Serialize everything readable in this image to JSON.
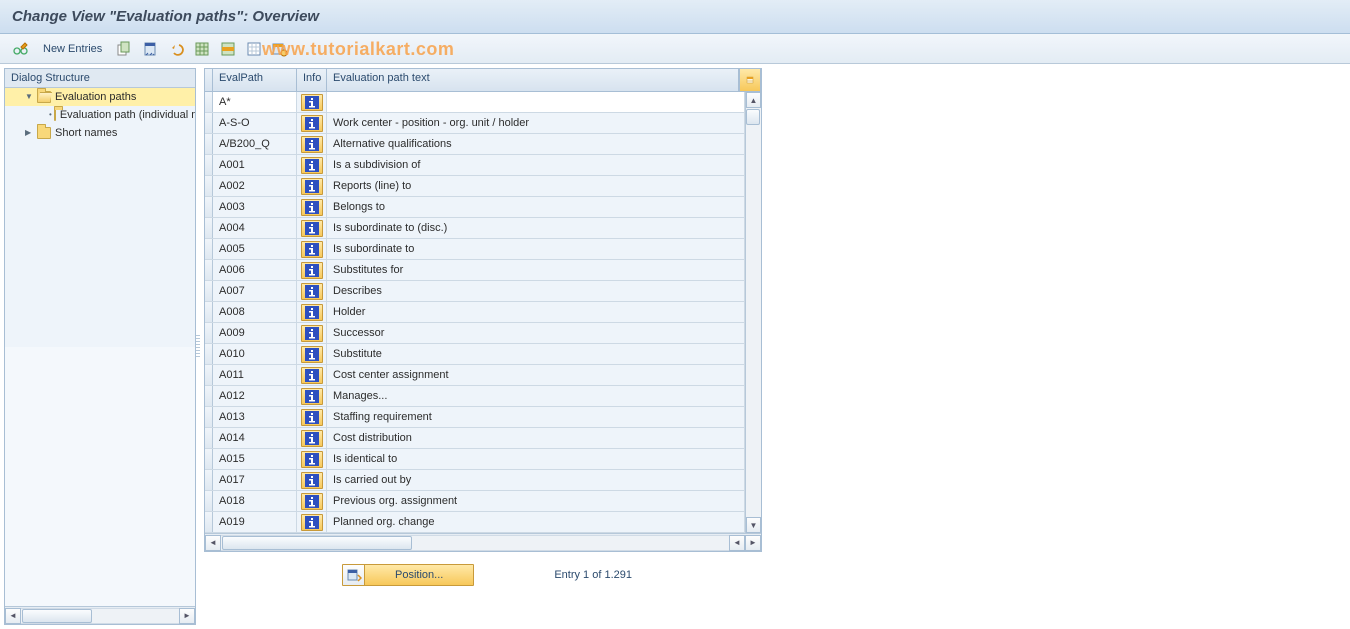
{
  "title": "Change View \"Evaluation paths\": Overview",
  "watermark": "www.tutorialkart.com",
  "toolbar": {
    "new_entries": "New Entries"
  },
  "tree": {
    "header": "Dialog Structure",
    "items": [
      {
        "label": "Evaluation paths",
        "open": true,
        "level": 1,
        "selected": true
      },
      {
        "label": "Evaluation path (individual maint.)",
        "open": false,
        "level": 2,
        "selected": false
      },
      {
        "label": "Short names",
        "open": false,
        "level": 1,
        "selected": false
      }
    ]
  },
  "grid": {
    "headers": {
      "path": "EvalPath",
      "info": "Info",
      "text": "Evaluation path text"
    },
    "rows": [
      {
        "path": "A*",
        "text": "",
        "active": true
      },
      {
        "path": "A-S-O",
        "text": "Work center - position - org. unit / holder"
      },
      {
        "path": "A/B200_Q",
        "text": "Alternative qualifications"
      },
      {
        "path": "A001",
        "text": "Is a subdivision of"
      },
      {
        "path": "A002",
        "text": "Reports (line) to"
      },
      {
        "path": "A003",
        "text": "Belongs to"
      },
      {
        "path": "A004",
        "text": "Is subordinate to (disc.)"
      },
      {
        "path": "A005",
        "text": "Is subordinate to"
      },
      {
        "path": "A006",
        "text": "Substitutes for"
      },
      {
        "path": "A007",
        "text": "Describes"
      },
      {
        "path": "A008",
        "text": "Holder"
      },
      {
        "path": "A009",
        "text": "Successor"
      },
      {
        "path": "A010",
        "text": "Substitute"
      },
      {
        "path": "A011",
        "text": "Cost center assignment"
      },
      {
        "path": "A012",
        "text": "Manages..."
      },
      {
        "path": "A013",
        "text": "Staffing requirement"
      },
      {
        "path": "A014",
        "text": "Cost distribution"
      },
      {
        "path": "A015",
        "text": "Is identical to"
      },
      {
        "path": "A017",
        "text": "Is carried out by"
      },
      {
        "path": "A018",
        "text": "Previous org. assignment"
      },
      {
        "path": "A019",
        "text": "Planned org. change"
      }
    ]
  },
  "footer": {
    "position_label": "Position...",
    "entry_text": "Entry 1 of 1.291"
  }
}
